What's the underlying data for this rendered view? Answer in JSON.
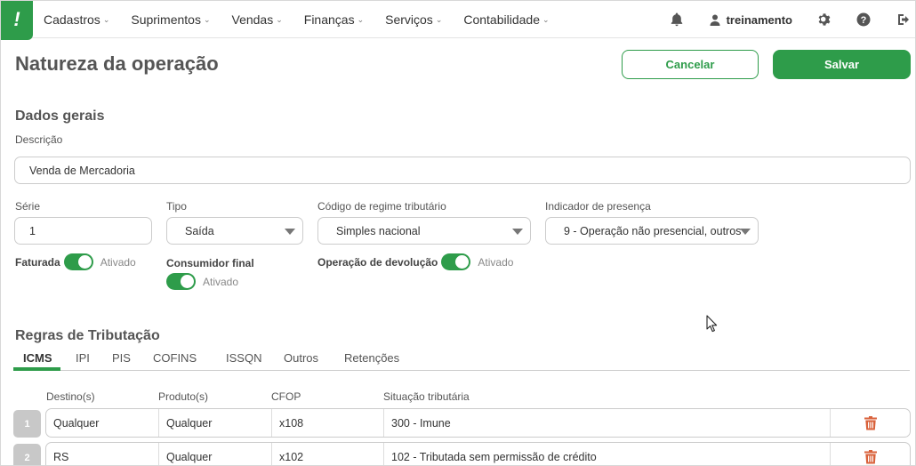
{
  "nav": {
    "logo": "!",
    "items": [
      {
        "label": "Cadastros"
      },
      {
        "label": "Suprimentos"
      },
      {
        "label": "Vendas"
      },
      {
        "label": "Finanças"
      },
      {
        "label": "Serviços"
      },
      {
        "label": "Contabilidade"
      }
    ],
    "user": "treinamento",
    "icons": [
      "bell-icon",
      "user-icon",
      "gear-icon",
      "help-icon",
      "logout-icon"
    ]
  },
  "header": {
    "title": "Natureza da operação",
    "cancel_label": "Cancelar",
    "save_label": "Salvar"
  },
  "general": {
    "section_title": "Dados gerais",
    "descricao_label": "Descrição",
    "descricao_value": "Venda de Mercadoria",
    "serie_label": "Série",
    "serie_value": "1",
    "tipo_label": "Tipo",
    "tipo_value": "Saída",
    "regime_label": "Código de regime tributário",
    "regime_value": "Simples nacional",
    "presenca_label": "Indicador de presença",
    "presenca_value": "9 - Operação não presencial, outros",
    "faturada_label": "Faturada",
    "faturada_state": "Ativado",
    "consumidor_label": "Consumidor final",
    "consumidor_state": "Ativado",
    "devolucao_label": "Operação de devolução",
    "devolucao_state": "Ativado"
  },
  "rules": {
    "section_title": "Regras de Tributação",
    "tabs": [
      "ICMS",
      "IPI",
      "PIS",
      "COFINS",
      "ISSQN",
      "Outros",
      "Retenções"
    ],
    "active_tab": "ICMS",
    "columns": [
      "Destino(s)",
      "Produto(s)",
      "CFOP",
      "Situação tributária"
    ],
    "rows": [
      {
        "num": "1",
        "destino": "Qualquer",
        "produto": "Qualquer",
        "cfop": "x108",
        "situacao": "300 - Imune"
      },
      {
        "num": "2",
        "destino": "RS",
        "produto": "Qualquer",
        "cfop": "x102",
        "situacao": "102 - Tributada sem permissão de crédito"
      }
    ]
  },
  "colors": {
    "accent": "#2e9c4a",
    "danger": "#d9623b"
  }
}
